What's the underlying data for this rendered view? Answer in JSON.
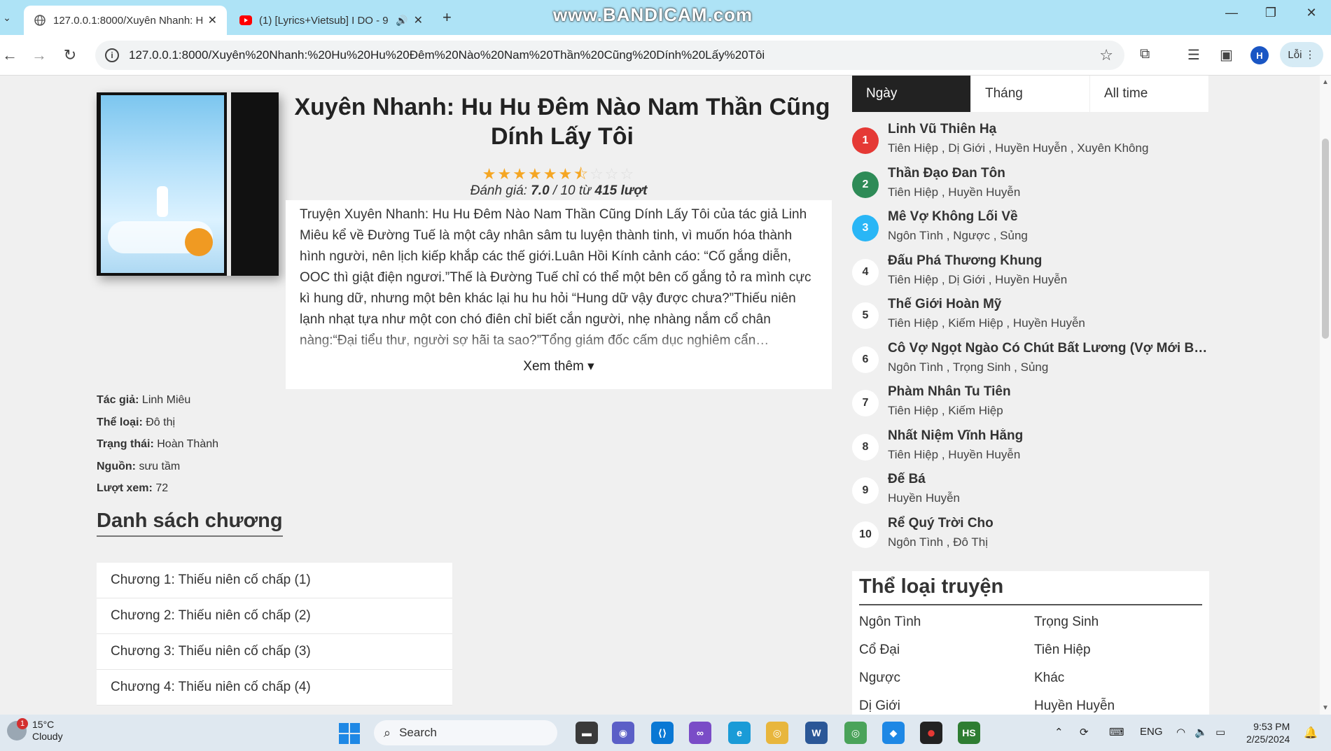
{
  "browser": {
    "tabs": [
      {
        "title": "127.0.0.1:8000/Xuyên Nhanh: H",
        "active": true
      },
      {
        "title": "(1) [Lyrics+Vietsub] I DO - 9",
        "active": false
      }
    ],
    "watermark": "www.BANDICAM.com",
    "url": "127.0.0.1:8000/Xuyên%20Nhanh:%20Hu%20Hu%20Đêm%20Nào%20Nam%20Thần%20Cũng%20Dính%20Lấy%20Tôi",
    "profile_initial": "H",
    "error_label": "Lỗi"
  },
  "book": {
    "title": "Xuyên Nhanh: Hu Hu Đêm Nào Nam Thần Cũng Dính Lấy Tôi",
    "rating_prefix": "Đánh giá: ",
    "rating_value": "7.0",
    "rating_mid": " / 10 từ ",
    "rating_count": "415 lượt",
    "rating": 7.0,
    "rating_max": 10,
    "description": "Truyện Xuyên Nhanh: Hu Hu Đêm Nào Nam Thần Cũng Dính Lấy Tôi của tác giả Linh Miêu kể về Đường Tuế là một cây nhân sâm tu luyện thành tinh, vì muốn hóa thành hình người, nên lịch kiếp khắp các thế giới.Luân Hồi Kính cảnh cáo: “Cố gắng diễn, OOC thì giật điện ngươi.”Thế là Đường Tuế chỉ có thể một bên cố gắng tỏ ra mình cực kì hung dữ, nhưng một bên khác lại hu hu hỏi “Hung dữ vậy được chưa?”Thiếu niên lạnh nhạt tựa như một con chó điên chỉ biết cắn người, nhẹ nhàng nắm cổ chân nàng:“Đại tiểu thư, người sợ hãi ta sao?”Tổng giám đốc cấm dục nghiêm cẩn…",
    "see_more": "Xem thêm",
    "meta": {
      "author_label": "Tác giả:",
      "author": "Linh Miêu",
      "genre_label": "Thể loại:",
      "genre": "Đô thị",
      "status_label": "Trạng thái:",
      "status": "Hoàn Thành",
      "source_label": "Nguồn:",
      "source": "sưu tầm",
      "views_label": "Lượt xem:",
      "views": "72"
    }
  },
  "chapters": {
    "heading": "Danh sách chương",
    "items": [
      "Chương 1: Thiếu niên cố chấp (1)",
      "Chương 2: Thiếu niên cố chấp (2)",
      "Chương 3: Thiếu niên cố chấp (3)",
      "Chương 4: Thiếu niên cố chấp (4)"
    ]
  },
  "ranking": {
    "tabs": [
      "Ngày",
      "Tháng",
      "All time"
    ],
    "active_tab": 0,
    "items": [
      {
        "rank": "1",
        "name": "Linh Vũ Thiên Hạ",
        "genres": "Tiên Hiệp , Dị Giới , Huyền Huyễn , Xuyên Không"
      },
      {
        "rank": "2",
        "name": "Thần Đạo Đan Tôn",
        "genres": "Tiên Hiệp , Huyền Huyễn"
      },
      {
        "rank": "3",
        "name": "Mê Vợ Không Lối Về",
        "genres": "Ngôn Tình , Ngược , Sủng"
      },
      {
        "rank": "4",
        "name": "Đấu Phá Thương Khung",
        "genres": "Tiên Hiệp , Dị Giới , Huyền Huyễn"
      },
      {
        "rank": "5",
        "name": "Thế Giới Hoàn Mỹ",
        "genres": "Tiên Hiệp , Kiếm Hiệp , Huyền Huyễn"
      },
      {
        "rank": "6",
        "name": "Cô Vợ Ngọt Ngào Có Chút Bất Lương (Vợ Mới Bất Lương Có Chút Ngọt)",
        "genres": "Ngôn Tình , Trọng Sinh , Sủng"
      },
      {
        "rank": "7",
        "name": "Phàm Nhân Tu Tiên",
        "genres": "Tiên Hiệp , Kiếm Hiệp"
      },
      {
        "rank": "8",
        "name": "Nhất Niệm Vĩnh Hằng",
        "genres": "Tiên Hiệp , Huyền Huyễn"
      },
      {
        "rank": "9",
        "name": "Đế Bá",
        "genres": "Huyền Huyễn"
      },
      {
        "rank": "10",
        "name": "Rể Quý Trời Cho",
        "genres": "Ngôn Tình , Đô Thị"
      }
    ]
  },
  "genres": {
    "heading": "Thể loại truyện",
    "items": [
      "Ngôn Tình",
      "Trọng Sinh",
      "Cổ Đại",
      "Tiên Hiệp",
      "Ngược",
      "Khác",
      "Dị Giới",
      "Huyền Huyễn"
    ]
  },
  "taskbar": {
    "weather_temp": "15°C",
    "weather_desc": "Cloudy",
    "weather_badge": "1",
    "search_label": "Search",
    "lang": "ENG",
    "time": "9:53 PM",
    "date": "2/25/2024"
  },
  "colors": {
    "rank1": "#e53935",
    "rank2": "#2e8b57",
    "rank3": "#29b6f6",
    "star": "#f5a623",
    "tabstrip": "#aee3f6"
  }
}
